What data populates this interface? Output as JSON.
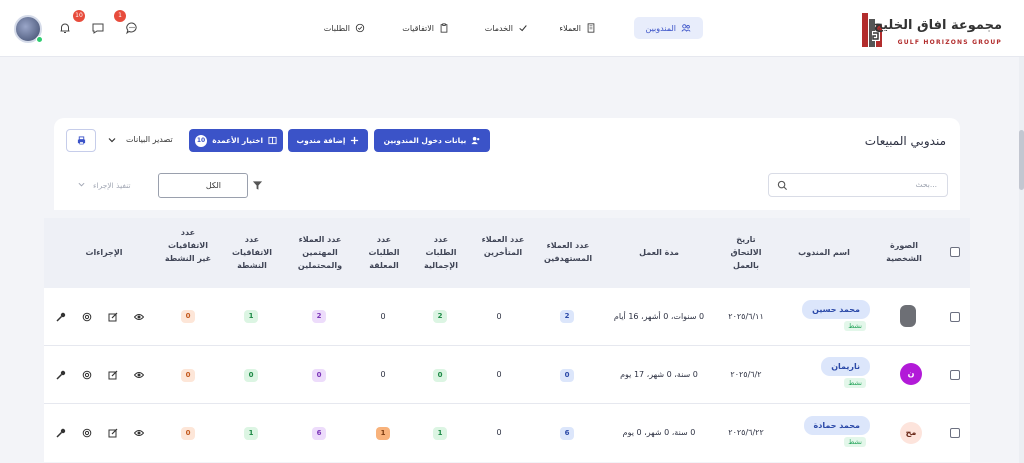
{
  "header": {
    "logo_ar": "مجموعة افاق الخليج",
    "logo_en": "GULF HORIZONS GROUP",
    "nav": [
      {
        "label": "المندوبين",
        "icon": "people-icon",
        "active": true
      },
      {
        "label": "العملاء",
        "icon": "building-icon",
        "active": false
      },
      {
        "label": "الخدمات",
        "icon": "check-icon",
        "active": false
      },
      {
        "label": "الاتفاقيات",
        "icon": "clipboard-icon",
        "active": false
      },
      {
        "label": "الطلبات",
        "icon": "check-circle-icon",
        "active": false
      }
    ],
    "messages_badge": "1",
    "notifications_badge": "10"
  },
  "card": {
    "title": "مندوبي المبيعات",
    "login_button": "بيانات دخول المندوبين",
    "add_button": "إضافة مندوب",
    "columns_button": "اختيار الأعمدة",
    "columns_count": "10",
    "export_label": "تصدير البيانات",
    "search_placeholder": "بحث...",
    "filter_value": "الكل",
    "bulk_action": "تنفيذ الإجراء"
  },
  "table": {
    "headers": {
      "photo": "الصورة الشخصية",
      "name": "اسم المندوب",
      "join_date": "تاريخ الالتحاق بالعمل",
      "duration": "مدة العمل",
      "target_clients": "عدد العملاء المستهدفين",
      "late_clients": "عدد العملاء المتأخرين",
      "total_orders": "عدد الطلبات الإجمالية",
      "closed_orders": "عدد الطلبات المعلقة",
      "interested_clients": "عدد العملاء المهتمين والمحتملين",
      "active_agreements": "عدد الاتفاقيات النشطة",
      "inactive_agreements": "عدد الاتفاقيات غير النشطة",
      "actions": "الإجراءات"
    },
    "status_active": "نشط",
    "rows": [
      {
        "name": "محمد حسين",
        "photo_initials": "",
        "join_date": "٢٠٢٥/٦/١١",
        "duration": "0 سنوات، 0 أشهر، 16 أيام",
        "target": "2",
        "late": "0",
        "total": "2",
        "closed": "0",
        "interested": "2",
        "active": "1",
        "inactive": "0"
      },
      {
        "name": "ناريمان",
        "photo_initials": "ن",
        "join_date": "٢٠٢٥/٦/٢",
        "duration": "0 سنة، 0 شهر، 17 يوم",
        "target": "0",
        "late": "0",
        "total": "0",
        "closed": "0",
        "interested": "0",
        "active": "0",
        "inactive": "0"
      },
      {
        "name": "محمد حمادة",
        "photo_initials": "مح",
        "join_date": "٢٠٢٥/٦/٢٢",
        "duration": "0 سنة، 0 شهر، 0 يوم",
        "target": "6",
        "late": "0",
        "total": "1",
        "closed": "1",
        "interested": "6",
        "active": "1",
        "inactive": "0"
      }
    ]
  }
}
